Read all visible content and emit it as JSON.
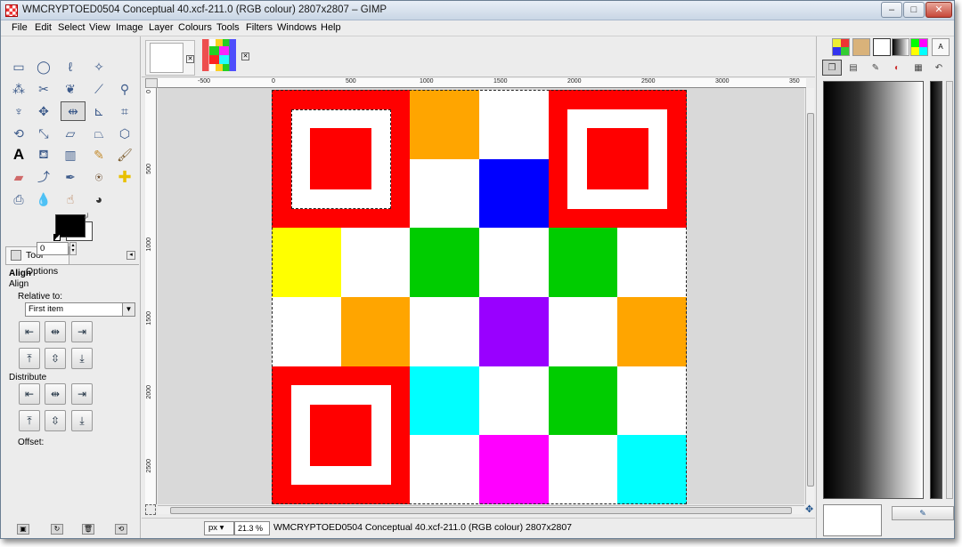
{
  "window": {
    "title": "WMCRYPTOED0504 Conceptual 40.xcf-211.0 (RGB colour) 2807x2807 – GIMP",
    "controls": {
      "minimize": "–",
      "maximize": "□",
      "close": "✕"
    }
  },
  "menubar": {
    "items": [
      "File",
      "Edit",
      "Select",
      "View",
      "Image",
      "Layer",
      "Colours",
      "Tools",
      "Filters",
      "Windows",
      "Help"
    ]
  },
  "toolbox": {
    "tools": [
      "rect-select",
      "ellipse-select",
      "free-select",
      "fuzzy-select",
      "select-by-color",
      "scissors-select",
      "foreground-select",
      "paths",
      "color-picker",
      "zoom",
      "measure",
      "move",
      "align",
      "crop",
      "rotate",
      "scale",
      "shear",
      "perspective",
      "flip",
      "cage-transform",
      "text",
      "bucket-fill",
      "blend",
      "pencil",
      "paintbrush",
      "eraser",
      "airbrush",
      "ink",
      "clone",
      "heal",
      "perspective-clone",
      "blur",
      "smudge",
      "dodge-burn"
    ],
    "active_tool": "align",
    "colors": {
      "foreground": "#000000",
      "background": "#ffffff"
    }
  },
  "tool_options": {
    "tab_label": "Tool Options",
    "title": "Align",
    "subtitle": "Align",
    "relative_to_label": "Relative to:",
    "relative_to_value": "First item",
    "distribute_label": "Distribute",
    "offset_label": "Offset:",
    "offset_value": "0"
  },
  "image_window": {
    "ruler_top_ticks": [
      "-500",
      "0",
      "500",
      "1000",
      "1500",
      "2000",
      "2500",
      "3000",
      "350"
    ],
    "ruler_left_ticks": [
      "0",
      "500",
      "1000",
      "1500",
      "2000",
      "2500"
    ],
    "unit": "px",
    "zoom": "21.3 %",
    "status": "WMCRYPTOED0504 Conceptual 40.xcf-211.0 (RGB colour) 2807x2807"
  },
  "qr_image": {
    "grid_size": 6,
    "colors": {
      "R": "#ff0000",
      "W": "#ffffff",
      "O": "#ffa500",
      "B": "#0000ff",
      "Y": "#ffff00",
      "G": "#00cc00",
      "P": "#9900ff",
      "C": "#00ffff",
      "M": "#ff00ff"
    },
    "finder_cells": [
      [
        "0",
        "0"
      ],
      [
        "0",
        "4"
      ],
      [
        "4",
        "0"
      ]
    ],
    "cells": [
      [
        "",
        "",
        "O",
        "W",
        "",
        ""
      ],
      [
        "",
        "",
        "W",
        "B",
        "",
        ""
      ],
      [
        "Y",
        "W",
        "G",
        "W",
        "G",
        "W"
      ],
      [
        "W",
        "O",
        "W",
        "P",
        "W",
        "O"
      ],
      [
        "",
        "",
        "C",
        "W",
        "G",
        "W"
      ],
      [
        "",
        "",
        "W",
        "M",
        "W",
        "C"
      ]
    ]
  },
  "dock": {
    "gradient_colors": [
      "#000000",
      "#ffffff"
    ]
  }
}
